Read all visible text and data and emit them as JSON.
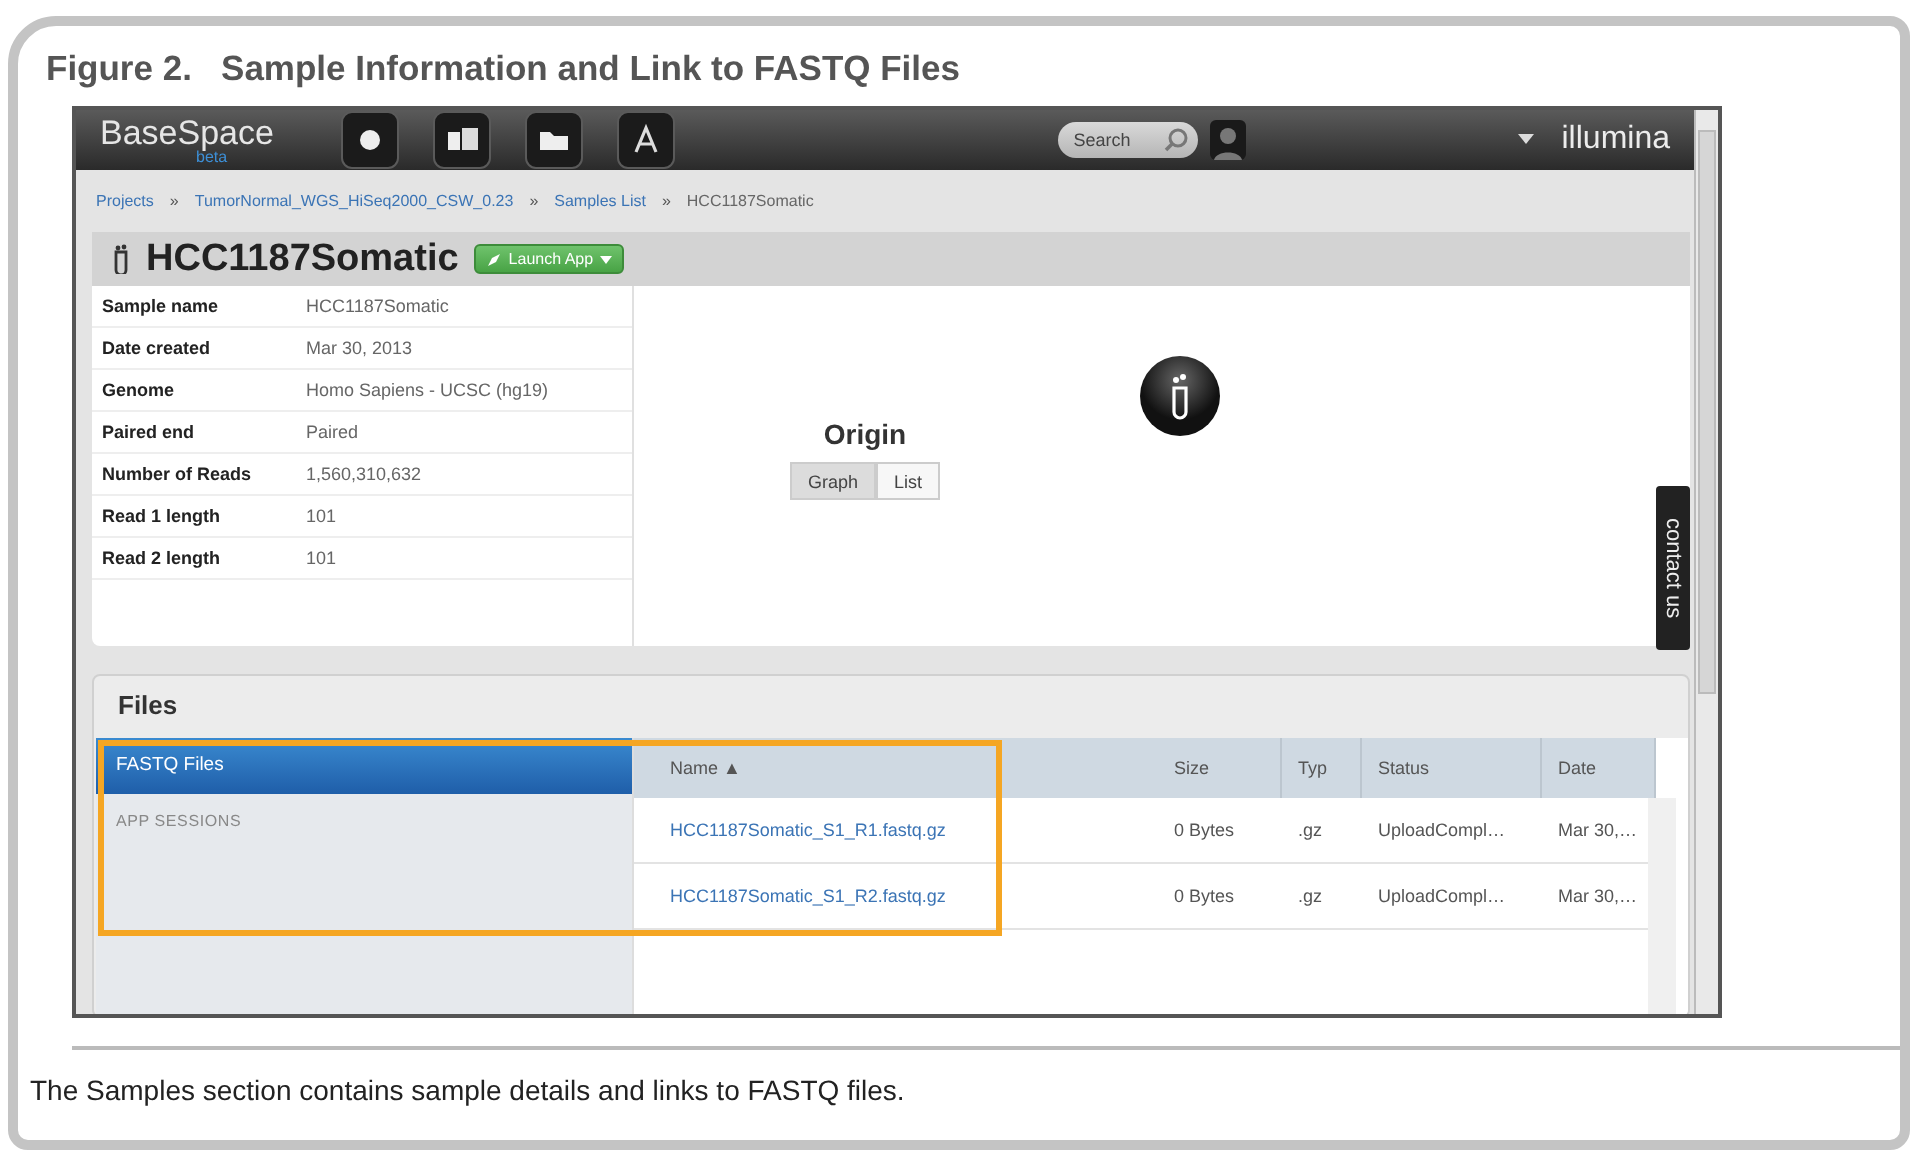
{
  "figure": {
    "title": "Figure 2.   Sample Information and Link to FASTQ Files",
    "caption": "The Samples section contains sample details and links to FASTQ files."
  },
  "topbar": {
    "logo": "BaseSpace",
    "logo_sub": "beta",
    "search": {
      "placeholder": "Search"
    },
    "brand": "illumina"
  },
  "breadcrumb": {
    "separator": "»",
    "items": [
      "Projects",
      "TumorNormal_WGS_HiSeq2000_CSW_0.23",
      "Samples List",
      "HCC1187Somatic"
    ]
  },
  "sample": {
    "name": "HCC1187Somatic",
    "launch_button": "Launch App",
    "details": [
      {
        "label": "Sample name",
        "value": "HCC1187Somatic"
      },
      {
        "label": "Date created",
        "value": "Mar 30, 2013"
      },
      {
        "label": "Genome",
        "value": "Homo Sapiens - UCSC (hg19)"
      },
      {
        "label": "Paired end",
        "value": "Paired"
      },
      {
        "label": "Number of Reads",
        "value": "1,560,310,632"
      },
      {
        "label": "Read 1 length",
        "value": "101"
      },
      {
        "label": "Read 2 length",
        "value": "101"
      }
    ]
  },
  "origin": {
    "title": "Origin",
    "toggle": [
      {
        "label": "Graph",
        "selected": true
      },
      {
        "label": "List",
        "selected": false
      }
    ]
  },
  "contact_tab": "contact us",
  "files": {
    "title": "Files",
    "categories": [
      {
        "label": "FASTQ Files",
        "selected": true
      },
      {
        "label": "APP SESSIONS",
        "selected": false
      }
    ],
    "columns": [
      {
        "label": "Name",
        "sort_mark": "▲"
      },
      {
        "label": "Size"
      },
      {
        "label": "Typ"
      },
      {
        "label": "Status"
      },
      {
        "label": "Date"
      }
    ],
    "rows": [
      {
        "name": "HCC1187Somatic_S1_R1.fastq.gz",
        "size": "0 Bytes",
        "type": ".gz",
        "status": "UploadCompl…",
        "date": "Mar 30,…"
      },
      {
        "name": "HCC1187Somatic_S1_R2.fastq.gz",
        "size": "0 Bytes",
        "type": ".gz",
        "status": "UploadCompl…",
        "date": "Mar 30,…"
      }
    ]
  }
}
